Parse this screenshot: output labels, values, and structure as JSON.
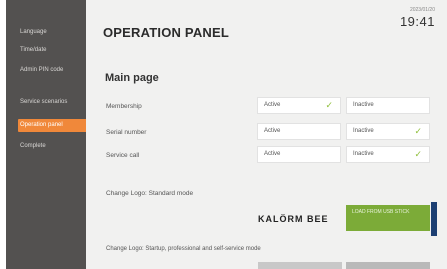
{
  "sidebar": {
    "items": [
      {
        "label": "Language",
        "active": false
      },
      {
        "label": "Time/date",
        "active": false
      },
      {
        "label": "Admin PIN code",
        "active": false
      },
      {
        "label": "Service scenarios",
        "active": false
      },
      {
        "label": "Operation panel",
        "active": true
      },
      {
        "label": "Complete",
        "active": false
      }
    ]
  },
  "header": {
    "title": "OPERATION PANEL",
    "date": "2023/01/20",
    "time": "19:41"
  },
  "main": {
    "section_title": "Main page",
    "rows": [
      {
        "label": "Membership",
        "active_label": "Active",
        "inactive_label": "Inactive",
        "selected": "active"
      },
      {
        "label": "Serial number",
        "active_label": "Active",
        "inactive_label": "Inactive",
        "selected": "inactive"
      },
      {
        "label": "Service call",
        "active_label": "Active",
        "inactive_label": "Inactive",
        "selected": "inactive"
      }
    ],
    "logo_label": "Change Logo: Standard mode",
    "logo_text": "KALÖRM BEE",
    "load_button": "LOAD FROM USB STICK",
    "bottom_label": "Change Logo: Startup, professional and self-service mode"
  },
  "colors": {
    "accent": "#f0883a",
    "check": "#8fbf3a",
    "load_button": "#7cab38",
    "sidebar": "#535150"
  }
}
